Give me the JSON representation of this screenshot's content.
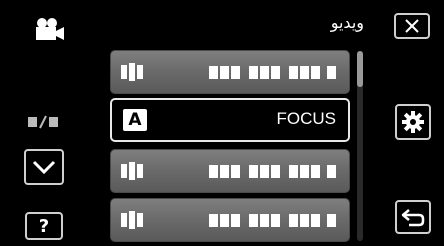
{
  "header": {
    "mode_icon": "video-camera-icon",
    "title": "ويديو",
    "close_icon": "close-icon"
  },
  "left_panel": {
    "page_indicator_icon": "page-indicator-icon",
    "down_icon": "chevron-down-icon",
    "help_label": "?"
  },
  "menu": {
    "items": [
      {
        "state": "placeholder"
      },
      {
        "state": "selected",
        "badge": "A",
        "label": "FOCUS"
      },
      {
        "state": "placeholder"
      },
      {
        "state": "placeholder"
      }
    ]
  },
  "scrollbar": {
    "position_fraction": 0.0
  },
  "right_panel": {
    "settings_icon": "gear-icon",
    "back_icon": "return-icon"
  },
  "colors": {
    "background": "#000000",
    "item_gray": "#707070",
    "placeholder_white": "#ffffff"
  }
}
